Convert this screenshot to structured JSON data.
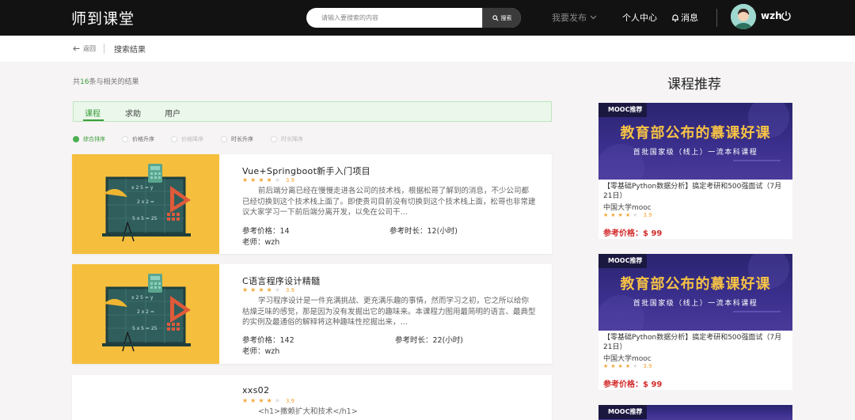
{
  "header": {
    "logo": "师到课堂",
    "search_placeholder": "请输入要搜索的内容",
    "search_button": "搜索",
    "nav_publish": "我要发布",
    "nav_center": "个人中心",
    "nav_messages": "消息",
    "username": "wzh"
  },
  "breadcrumb": {
    "back": "返回",
    "current": "搜索结果"
  },
  "results": {
    "count_prefix": "共",
    "count": "16",
    "count_suffix": "条与相关的结果",
    "tabs": [
      "课程",
      "求助",
      "用户"
    ],
    "sorts": [
      "综合排序",
      "价格升序",
      "价格降序",
      "时长升序",
      "时长降序"
    ]
  },
  "courses": [
    {
      "title": "Vue+Springboot新手入门项目",
      "rating": 3.9,
      "score": "3.9",
      "desc": "前后端分离已经在慢慢走进各公司的技术栈，根据松哥了解到的消息，不少公司都已经切换到这个技术栈上面了。即使贵司目前没有切换到这个技术栈上面，松哥也非常建议大家学习一下前后端分离开发，以免在公司干…",
      "price_label": "参考价格：",
      "price": "14",
      "duration_label": "参考时长：",
      "duration": "12(小时)",
      "teacher_label": "老师：",
      "teacher": "wzh"
    },
    {
      "title": "C语言程序设计精髓",
      "rating": 3.9,
      "score": "3.9",
      "desc": "学习程序设计是一件充满挑战、更充满乐趣的事情，然而学习之初，它之所以给你枯燥乏味的感觉，那是因为没有发掘出它的趣味来。本课程力图用最简明的语言、最典型的实例及最通俗的解释将这种趣味性挖掘出来，…",
      "price_label": "参考价格：",
      "price": "142",
      "duration_label": "参考时长：",
      "duration": "22(小时)",
      "teacher_label": "老师：",
      "teacher": "wzh"
    },
    {
      "title": "xxs02",
      "rating": 3.9,
      "score": "3.9",
      "desc": "<h1>撒赖扩大和技术</h1>"
    }
  ],
  "recommend": {
    "title": "课程推荐",
    "items": [
      {
        "badge": "MOOC推荐",
        "headline": "教育部公布的慕课好课",
        "subline": "首批国家级（线上）一流本科课程",
        "text": "【零基础Python数据分析】搞定考研和500强面试（7月21日）",
        "university": "中国大学mooc",
        "rating": 3.9,
        "score": "3.9",
        "price_label": "参考价格：",
        "price": "$ 99"
      },
      {
        "badge": "MOOC推荐",
        "headline": "教育部公布的慕课好课",
        "subline": "首批国家级（线上）一流本科课程",
        "text": "【零基础Python数据分析】搞定考研和500强面试（7月21日）",
        "university": "中国大学mooc",
        "rating": 3.9,
        "score": "3.9",
        "price_label": "参考价格：",
        "price": "$ 99"
      },
      {
        "badge": "MOOC推荐"
      }
    ]
  },
  "colors": {
    "accent": "#3a9d3a",
    "star": "#f3a536",
    "price": "#d32b2b",
    "header": "#121212"
  }
}
